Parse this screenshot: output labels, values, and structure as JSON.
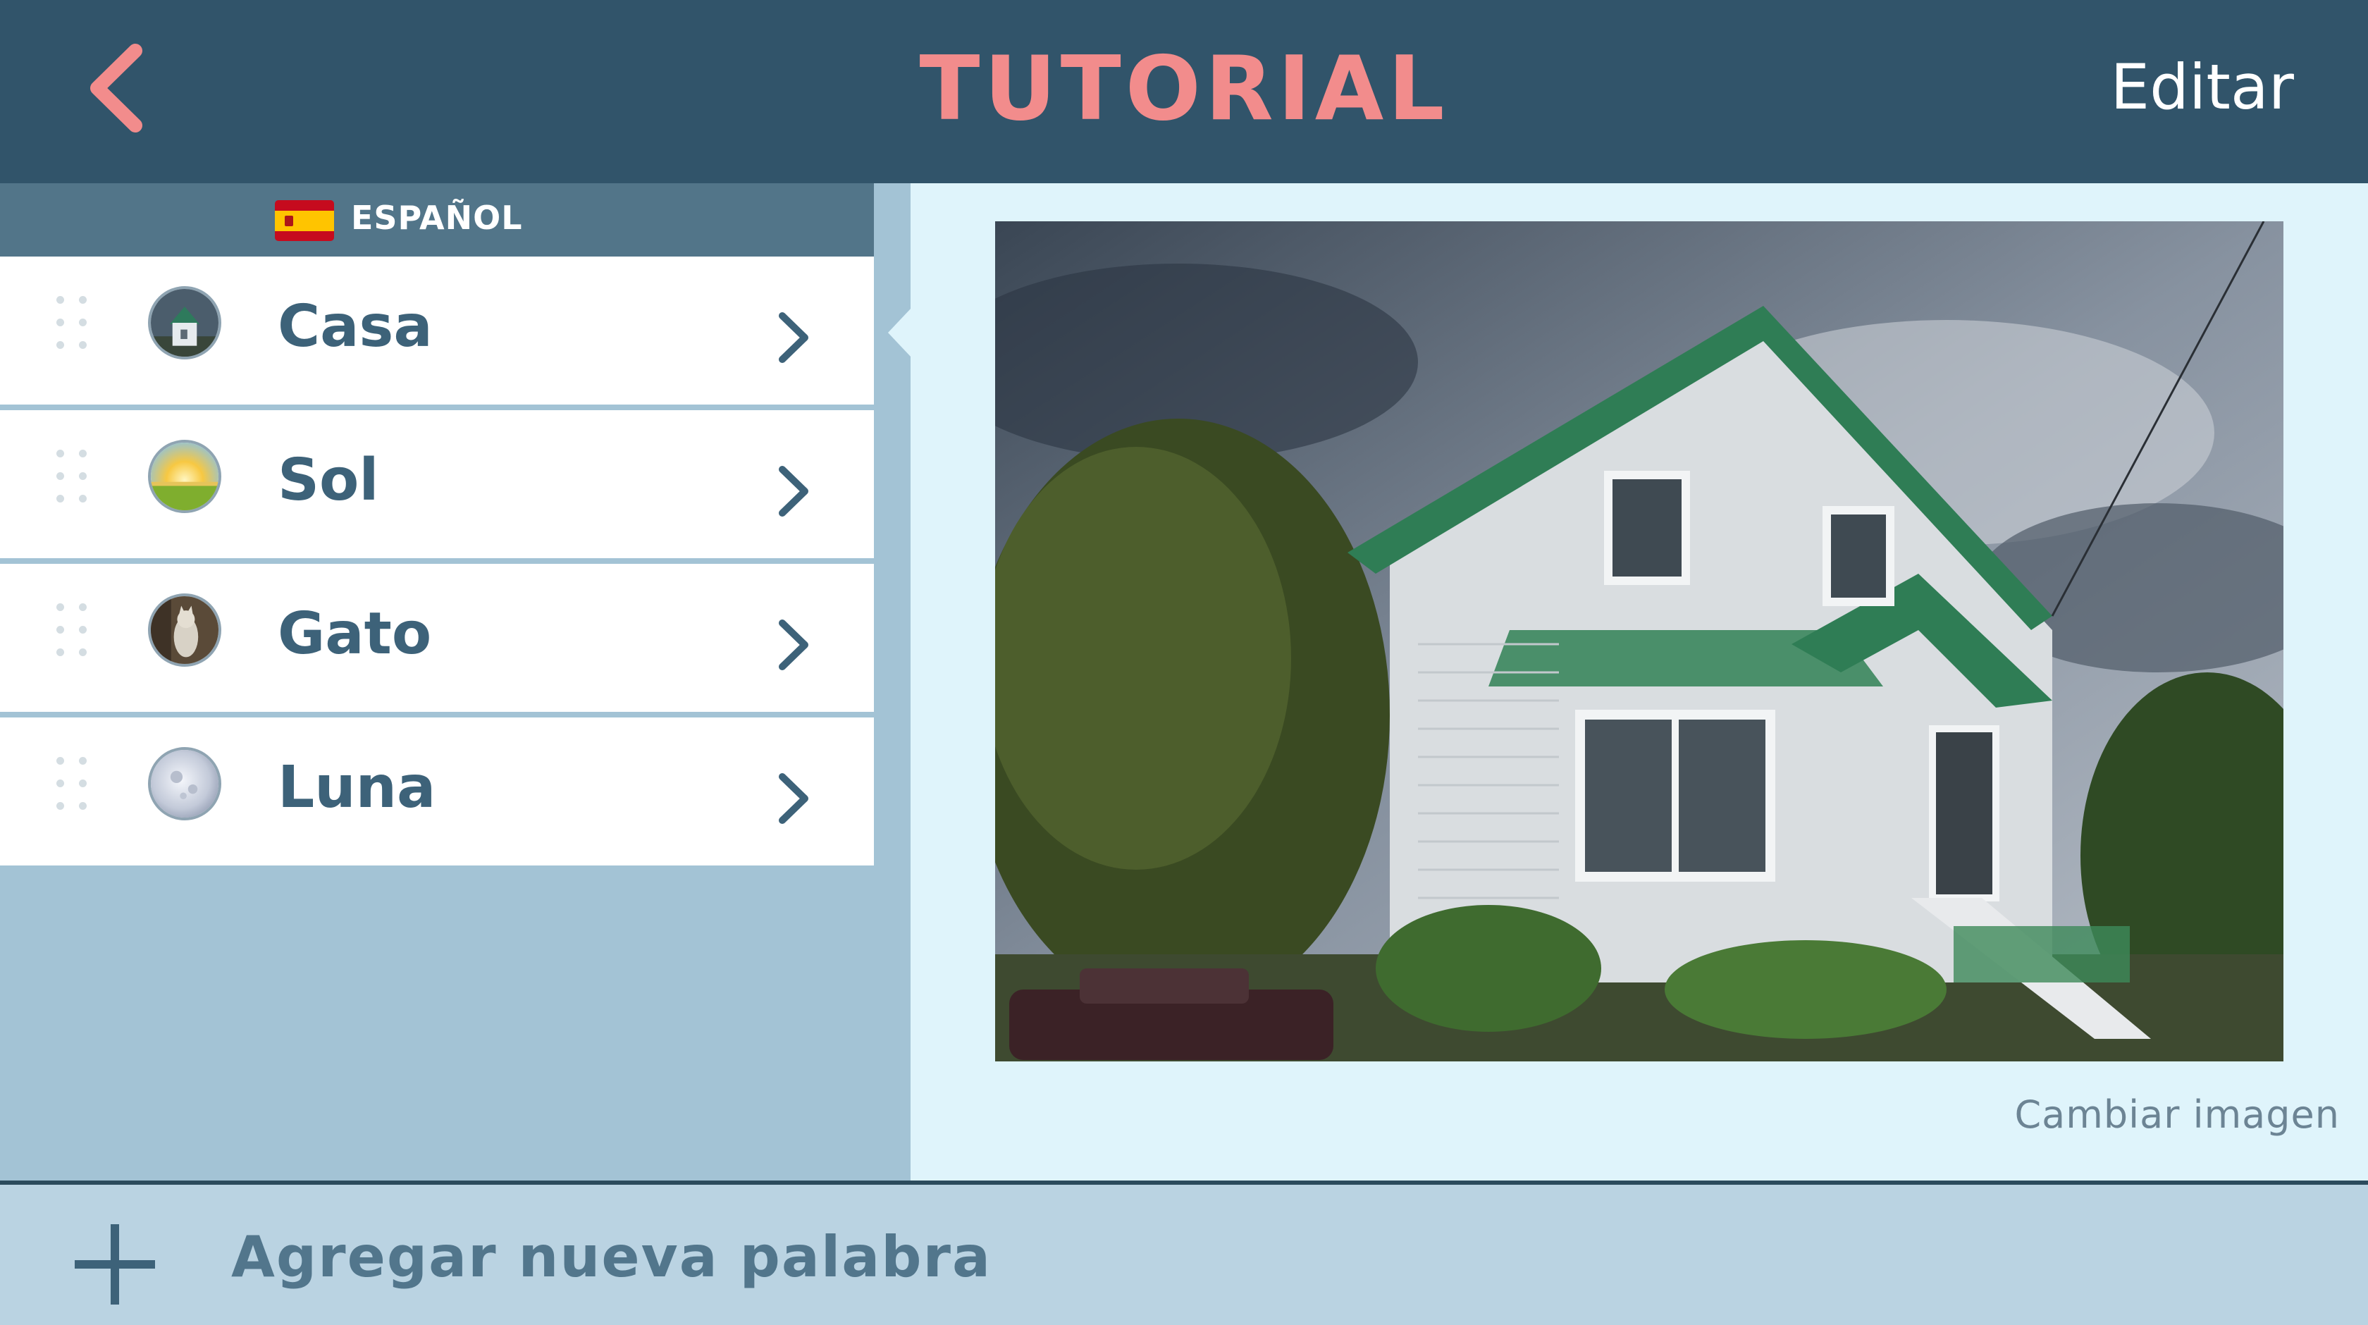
{
  "header": {
    "title": "TUTORIAL",
    "edit_label": "Editar",
    "back_icon": "chevron-left-icon"
  },
  "language": {
    "label": "ESPAÑOL",
    "flag_icon": "spain-flag-icon"
  },
  "words": [
    {
      "label": "Casa",
      "thumb": "house-thumbnail"
    },
    {
      "label": "Sol",
      "thumb": "sun-thumbnail"
    },
    {
      "label": "Gato",
      "thumb": "cat-thumbnail"
    },
    {
      "label": "Luna",
      "thumb": "moon-thumbnail"
    }
  ],
  "detail": {
    "change_image_label": "Cambiar imagen",
    "image_subject": "house"
  },
  "footer": {
    "add_label": "Agregar nueva palabra",
    "add_icon": "plus-icon"
  },
  "colors": {
    "header_bg": "#31546a",
    "accent": "#f28c8c",
    "left_bg": "#a3c3d5",
    "right_bg": "#dff4fb",
    "footer_bg": "#bad3e2",
    "text_dark": "#3d6279"
  }
}
